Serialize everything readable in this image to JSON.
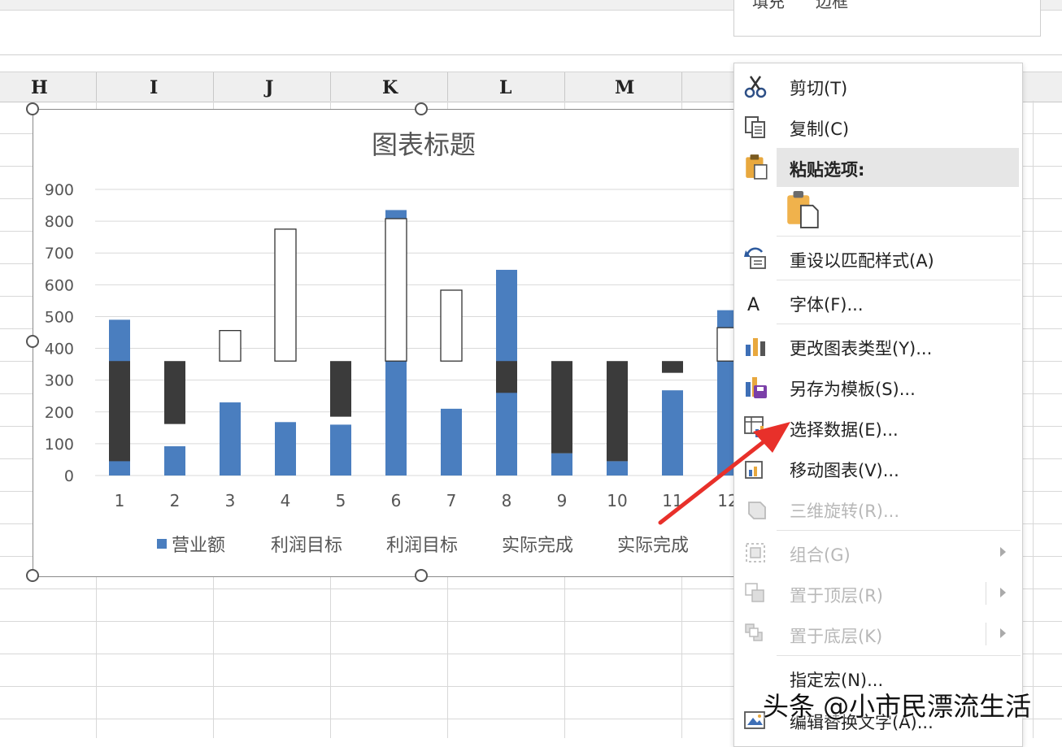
{
  "spreadsheet": {
    "columns": [
      "H",
      "I",
      "J",
      "K",
      "L",
      "M"
    ]
  },
  "top_panel": {
    "left_text": "填充",
    "right_text": "边框"
  },
  "context_menu": {
    "items": [
      {
        "label": "剪切(T)",
        "icon": "scissors-icon"
      },
      {
        "label": "复制(C)",
        "icon": "copy-icon"
      },
      {
        "label": "粘贴选项:",
        "icon": "paste-icon"
      },
      {
        "label": "",
        "icon": "paste-keep-icon"
      },
      {
        "label": "重设以匹配样式(A)",
        "icon": "reset-style-icon"
      },
      {
        "label": "字体(F)...",
        "icon": "font-icon"
      },
      {
        "label": "更改图表类型(Y)...",
        "icon": "chart-type-icon"
      },
      {
        "label": "另存为模板(S)...",
        "icon": "save-template-icon"
      },
      {
        "label": "选择数据(E)...",
        "icon": "select-data-icon"
      },
      {
        "label": "移动图表(V)...",
        "icon": "move-chart-icon"
      },
      {
        "label": "三维旋转(R)...",
        "icon": "rotate-3d-icon"
      },
      {
        "label": "组合(G)",
        "icon": "group-icon"
      },
      {
        "label": "置于顶层(R)",
        "icon": "bring-front-icon"
      },
      {
        "label": "置于底层(K)",
        "icon": "send-back-icon"
      },
      {
        "label": "指定宏(N)...",
        "icon": "macro-icon"
      },
      {
        "label": "编辑替换文字(A)...",
        "icon": "alt-text-icon"
      }
    ]
  },
  "watermark": "头条 @小市民漂流生活",
  "colors": {
    "blue": "#4a7ebf",
    "dark": "#3b3b3b",
    "white_bar_stroke": "#333333",
    "annotation_arrow": "#e8302a"
  },
  "chart_data": {
    "type": "bar",
    "stacked": true,
    "title": "图表标题",
    "categories": [
      "1",
      "2",
      "3",
      "4",
      "5",
      "6",
      "7",
      "8",
      "9",
      "10",
      "11",
      "12"
    ],
    "ylim": [
      0,
      900
    ],
    "yticks": [
      "0",
      "100",
      "200",
      "300",
      "400",
      "500",
      "600",
      "700",
      "800",
      "900"
    ],
    "grid": true,
    "legend_position": "bottom",
    "legend": [
      "营业额",
      "利润目标",
      "利润目标",
      "实际完成",
      "实际完成"
    ],
    "bars": [
      {
        "category": "1",
        "segments": [
          {
            "from": 0,
            "to": 490,
            "fill": "blue"
          },
          {
            "from": 45,
            "to": 360,
            "fill": "dark"
          }
        ]
      },
      {
        "category": "2",
        "segments": [
          {
            "from": 0,
            "to": 92,
            "fill": "blue"
          },
          {
            "from": 162,
            "to": 360,
            "fill": "dark"
          }
        ]
      },
      {
        "category": "3",
        "segments": [
          {
            "from": 0,
            "to": 230,
            "fill": "blue"
          },
          {
            "from": 360,
            "to": 456,
            "fill": "white"
          }
        ]
      },
      {
        "category": "4",
        "segments": [
          {
            "from": 0,
            "to": 168,
            "fill": "blue"
          },
          {
            "from": 360,
            "to": 775,
            "fill": "white"
          }
        ]
      },
      {
        "category": "5",
        "segments": [
          {
            "from": 0,
            "to": 160,
            "fill": "blue"
          },
          {
            "from": 185,
            "to": 360,
            "fill": "dark"
          }
        ]
      },
      {
        "category": "6",
        "segments": [
          {
            "from": 0,
            "to": 835,
            "fill": "blue"
          },
          {
            "from": 360,
            "to": 808,
            "fill": "white"
          }
        ]
      },
      {
        "category": "7",
        "segments": [
          {
            "from": 0,
            "to": 210,
            "fill": "blue"
          },
          {
            "from": 360,
            "to": 583,
            "fill": "white"
          }
        ]
      },
      {
        "category": "8",
        "segments": [
          {
            "from": 0,
            "to": 647,
            "fill": "blue"
          },
          {
            "from": 260,
            "to": 360,
            "fill": "dark"
          }
        ]
      },
      {
        "category": "9",
        "segments": [
          {
            "from": 0,
            "to": 70,
            "fill": "blue"
          },
          {
            "from": 70,
            "to": 360,
            "fill": "dark"
          }
        ]
      },
      {
        "category": "10",
        "segments": [
          {
            "from": 0,
            "to": 45,
            "fill": "blue"
          },
          {
            "from": 45,
            "to": 360,
            "fill": "dark"
          }
        ]
      },
      {
        "category": "11",
        "segments": [
          {
            "from": 0,
            "to": 268,
            "fill": "blue"
          },
          {
            "from": 323,
            "to": 360,
            "fill": "dark"
          }
        ]
      },
      {
        "category": "12",
        "segments": [
          {
            "from": 0,
            "to": 520,
            "fill": "blue"
          },
          {
            "from": 360,
            "to": 465,
            "fill": "white"
          }
        ]
      }
    ]
  }
}
